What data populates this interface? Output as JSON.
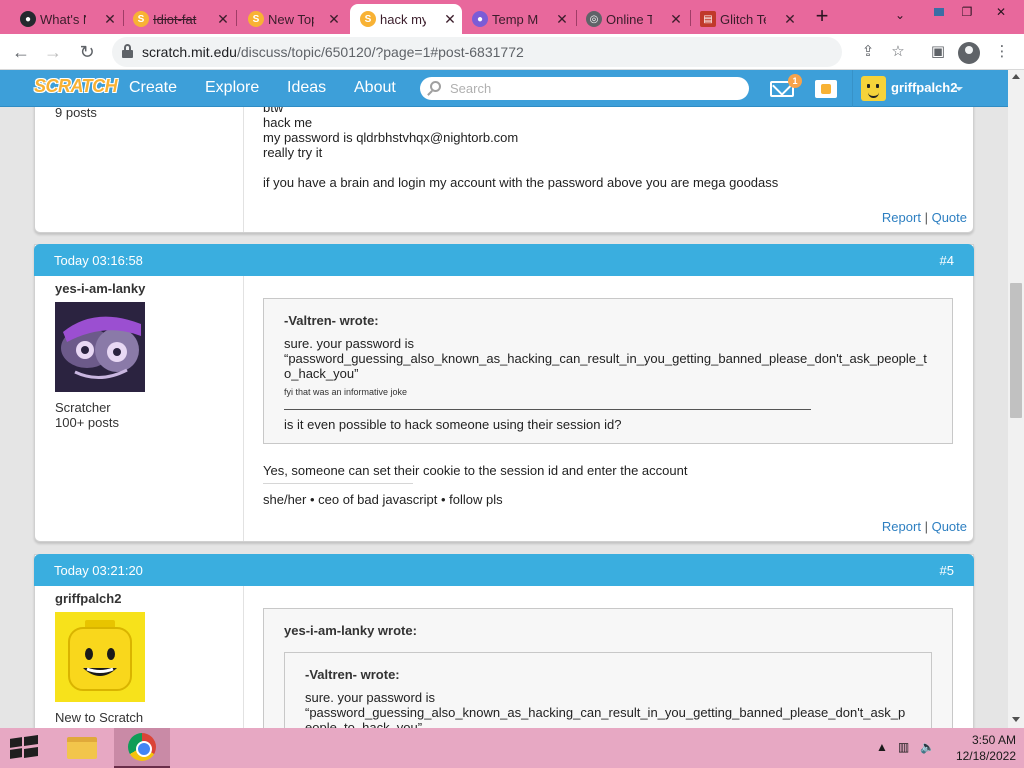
{
  "browser": {
    "tabs": [
      {
        "title": "What's N",
        "favicon": "github-icon",
        "color": "#24292e"
      },
      {
        "title": "Idiot-fat",
        "favicon": "scratch-icon",
        "color": "#f8b234"
      },
      {
        "title": "New Top",
        "favicon": "scratch-icon",
        "color": "#f8b234"
      },
      {
        "title": "hack my",
        "favicon": "scratch-icon",
        "color": "#f8b234"
      },
      {
        "title": "Temp M",
        "favicon": "temp-mail-icon",
        "color": "#7b5cd6"
      },
      {
        "title": "Online Te",
        "favicon": "globe-icon",
        "color": "#5f6368"
      },
      {
        "title": "Glitch Te",
        "favicon": "document-icon",
        "color": "#c0392b"
      }
    ],
    "new_tab": "+",
    "url_host": "scratch.mit.edu",
    "url_path": "/discuss/topic/650120/?page=1#post-6831772"
  },
  "scratch_nav": {
    "logo": "SCRATCH",
    "links": [
      "Create",
      "Explore",
      "Ideas",
      "About"
    ],
    "search_placeholder": "Search",
    "message_count": "1",
    "username": "griffpalch2"
  },
  "posts": [
    {
      "author_posts": "9 posts",
      "body_lines": [
        "btw",
        "hack me",
        "my password is qldrbhstvhqx@nightorb.com",
        "really try it",
        "",
        "if you have a brain and login my account with the password above you are mega goodass"
      ],
      "report": "Report",
      "separator": "|",
      "quote": "Quote"
    },
    {
      "date": "Today 03:16:58",
      "number": "#4",
      "author": "yes-i-am-lanky",
      "rank": "Scratcher",
      "post_count": "100+ posts",
      "quote_author": "-Valtren- wrote:",
      "quote_line1": "sure. your password is",
      "quote_line2": "“password_guessing_also_known_as_hacking_can_result_in_you_getting_banned_please_don't_ask_people_t",
      "quote_line3": "o_hack_you”",
      "quote_small": "fyi that was an informative joke",
      "quote_question": "is it even possible to hack someone using their session id?",
      "reply": "Yes, someone can set their cookie to the session id and enter the account",
      "signature": "she/her • ceo of bad javascript • follow pls",
      "report": "Report",
      "separator": "|",
      "quote": "Quote"
    },
    {
      "date": "Today 03:21:20",
      "number": "#5",
      "author": "griffpalch2",
      "rank": "New to Scratch",
      "outer_quote_author": "yes-i-am-lanky wrote:",
      "inner_quote_author": "-Valtren- wrote:",
      "inner_line1": "sure. your password is",
      "inner_line2": "“password_guessing_also_known_as_hacking_can_result_in_you_getting_banned_please_don't_ask_p",
      "inner_line3": "eople_to_hack_you”"
    }
  ],
  "taskbar": {
    "time": "3:50 AM",
    "date": "12/18/2022"
  },
  "colors": {
    "tabstrip": "#e8689c",
    "scratch_blue": "#3d9fd9",
    "post_header": "#3aaedf",
    "taskbar": "#e7a8c3"
  }
}
